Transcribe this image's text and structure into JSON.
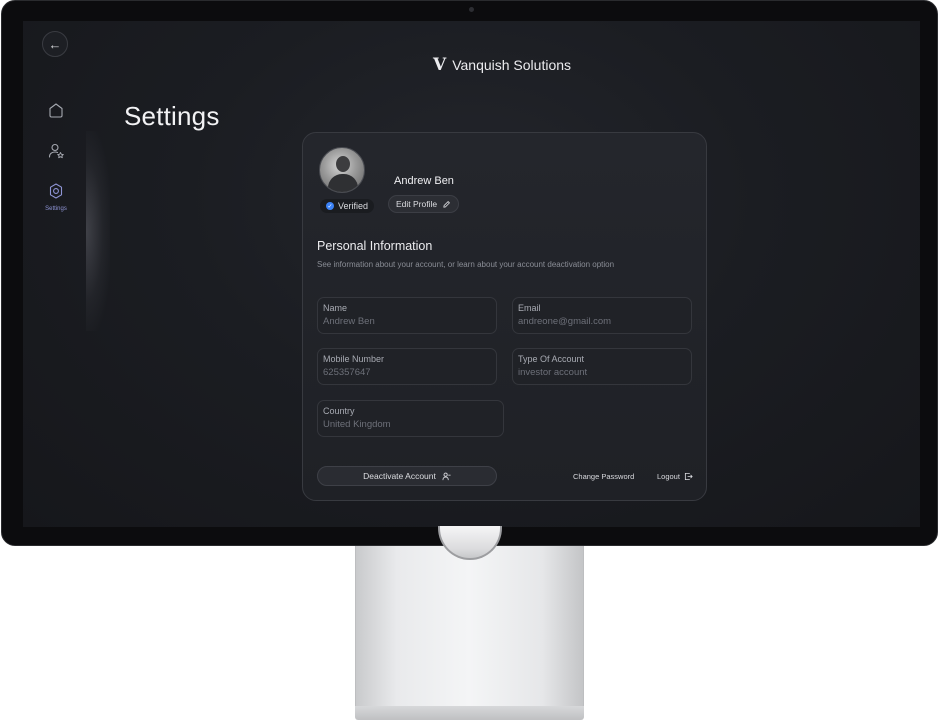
{
  "brand": {
    "logo": "V",
    "name": "Vanquish Solutions"
  },
  "sidebar": {
    "back_icon": "arrow-left-icon",
    "items": [
      {
        "icon": "home-icon",
        "label": ""
      },
      {
        "icon": "user-star-icon",
        "label": ""
      },
      {
        "icon": "settings-gear-icon",
        "label": "Settings",
        "active": true
      }
    ]
  },
  "page": {
    "title": "Settings"
  },
  "profile": {
    "name": "Andrew Ben",
    "verified_label": "Verified",
    "edit_label": "Edit Profile"
  },
  "personal_info": {
    "title": "Personal Information",
    "subtitle": "See information about your account, or learn about your account deactivation option",
    "fields": {
      "name": {
        "label": "Name",
        "value": "Andrew Ben"
      },
      "email": {
        "label": "Email",
        "value": "andreone@gmail.com"
      },
      "mobile": {
        "label": "Mobile Number",
        "value": "625357647"
      },
      "account_type": {
        "label": "Type Of Account",
        "value": "investor account"
      },
      "country": {
        "label": "Country",
        "value": "United Kingdom"
      }
    }
  },
  "actions": {
    "deactivate": "Deactivate Account",
    "change_password": "Change Password",
    "logout": "Logout"
  },
  "colors": {
    "accent": "#8f95d6",
    "verified": "#3b82f6",
    "background": "#1b1d22"
  }
}
